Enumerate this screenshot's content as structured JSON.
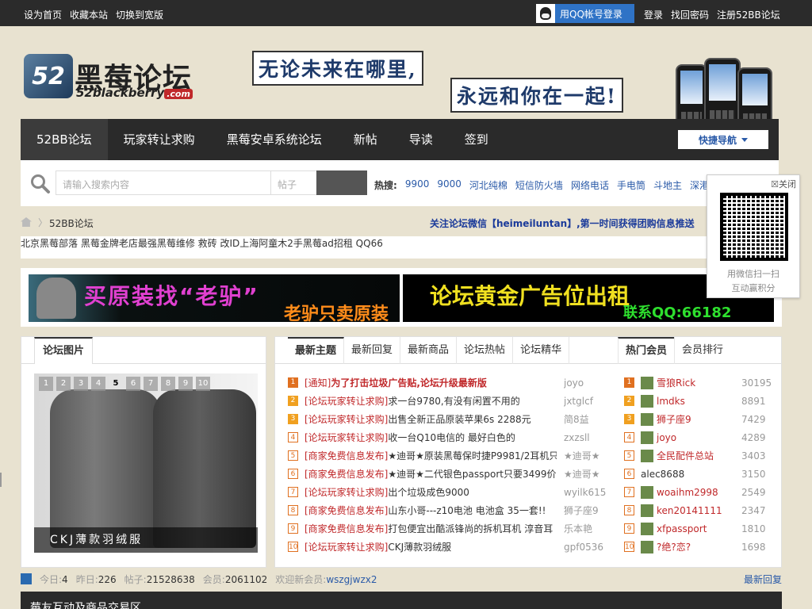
{
  "topbar": {
    "left_links": [
      "设为首页",
      "收藏本站",
      "切换到宽版"
    ],
    "qq_login": "用QQ帐号登录",
    "right_links": [
      "登录",
      "找回密码",
      "注册52BB论坛"
    ]
  },
  "logo": {
    "cn": "黑莓论坛",
    "en": "52blackberry",
    "com": ".com",
    "mark": "52"
  },
  "slogan": {
    "line1": "无论未来在哪里,",
    "line2": "永远和你在一起!"
  },
  "nav": {
    "items": [
      "52BB论坛",
      "玩家转让求购",
      "黑莓安卓系统论坛",
      "新帖",
      "导读",
      "签到"
    ],
    "quick": "快捷导航"
  },
  "search": {
    "placeholder": "请输入搜索内容",
    "type": "帖子",
    "hot_label": "热搜:",
    "hot": [
      "9900",
      "9000",
      "河北纯棉",
      "短信防火墙",
      "网络电话",
      "手电筒",
      "斗地主",
      "深港澳"
    ]
  },
  "qr": {
    "close": "关闭",
    "line1": "用微信扫一扫",
    "line2": "互动赢积分"
  },
  "breadcrumb": {
    "current": "52BB论坛",
    "notice": "关注论坛微信【heimeiluntan】,第一时间获得团购信息推送"
  },
  "text_ads": [
    "北京黑莓部落 黑莓金牌老店",
    "最强黑莓维修 救砖 改ID",
    "上海阿童木2手黑莓",
    "ad招租 QQ66"
  ],
  "banners": {
    "b1_t1": "买原装找“老驴”",
    "b1_t2": "老驴只卖原装",
    "b2_t1": "论坛黄金广告位出租",
    "b2_t2": "联系QQ:66182"
  },
  "pic": {
    "tab": "论坛图片",
    "pages": [
      "1",
      "2",
      "3",
      "4",
      "5",
      "6",
      "7",
      "8",
      "9",
      "10"
    ],
    "active_page": "5",
    "caption": "CKJ薄款羽绒服"
  },
  "thread_tabs": [
    "最新主题",
    "最新回复",
    "最新商品",
    "论坛热帖",
    "论坛精华"
  ],
  "member_tabs": [
    "热门会员",
    "会员排行"
  ],
  "threads": [
    {
      "n": "1",
      "cat": "[通知]",
      "title": "为了打击垃圾广告贴,论坛升级最新版",
      "bold": true,
      "author": "joyo"
    },
    {
      "n": "2",
      "cat": "[论坛玩家转让求购]",
      "title": "求一台9780,有没有闲置不用的",
      "author": "jxtglcf"
    },
    {
      "n": "3",
      "cat": "[论坛玩家转让求购]",
      "title": "出售全新正品原装苹果6s 2288元",
      "author": "简8益"
    },
    {
      "n": "4",
      "cat": "[论坛玩家转让求购]",
      "title": "收一台Q10电信的 最好白色的",
      "author": "zxzsll"
    },
    {
      "n": "5",
      "cat": "[商家免费信息发布]",
      "title": "★迪哥★原装黑莓保时捷P9981/2耳机只",
      "author": "★迪哥★"
    },
    {
      "n": "6",
      "cat": "[商家免费信息发布]",
      "title": "★迪哥★二代银色passport只要3499价",
      "author": "★迪哥★"
    },
    {
      "n": "7",
      "cat": "[论坛玩家转让求购]",
      "title": "出个垃圾成色9000",
      "author": "wyilk615"
    },
    {
      "n": "8",
      "cat": "[商家免费信息发布]",
      "title": "山东小哥---z10电池 电池盒 35一套!!",
      "author": "狮子座9"
    },
    {
      "n": "9",
      "cat": "[商家免费信息发布]",
      "title": "打包便宜出酷派锋尚的拆机耳机 淳音耳",
      "author": "乐本艳"
    },
    {
      "n": "10",
      "cat": "[论坛玩家转让求购]",
      "title": "CKJ薄款羽绒服",
      "author": "gpf0536"
    }
  ],
  "members": [
    {
      "n": "1",
      "name": "雪狼Rick",
      "score": "30195"
    },
    {
      "n": "2",
      "name": "lmdks",
      "score": "8891"
    },
    {
      "n": "3",
      "name": "狮子座9",
      "score": "7429"
    },
    {
      "n": "4",
      "name": "joyo",
      "score": "4289"
    },
    {
      "n": "5",
      "name": "全民配件总站",
      "score": "3403"
    },
    {
      "n": "6",
      "name": "alec8688",
      "score": "3150",
      "prefix": "alec8688"
    },
    {
      "n": "7",
      "name": "woaihm2998",
      "score": "2549"
    },
    {
      "n": "8",
      "name": "ken20141111",
      "score": "2347"
    },
    {
      "n": "9",
      "name": "xfpassport",
      "score": "1810"
    },
    {
      "n": "10",
      "name": "?绝?恋?",
      "score": "1698"
    }
  ],
  "stats": {
    "today_label": "今日:",
    "today": "4",
    "yesterday_label": "昨日:",
    "yesterday": "226",
    "posts_label": "帖子:",
    "posts": "21528638",
    "members_label": "会员:",
    "members": "2061102",
    "welcome_label": "欢迎新会员:",
    "welcome": "wszgjwzx2",
    "latest_reply": "最新回复"
  },
  "section_title": "莓友互动及商品交易区"
}
